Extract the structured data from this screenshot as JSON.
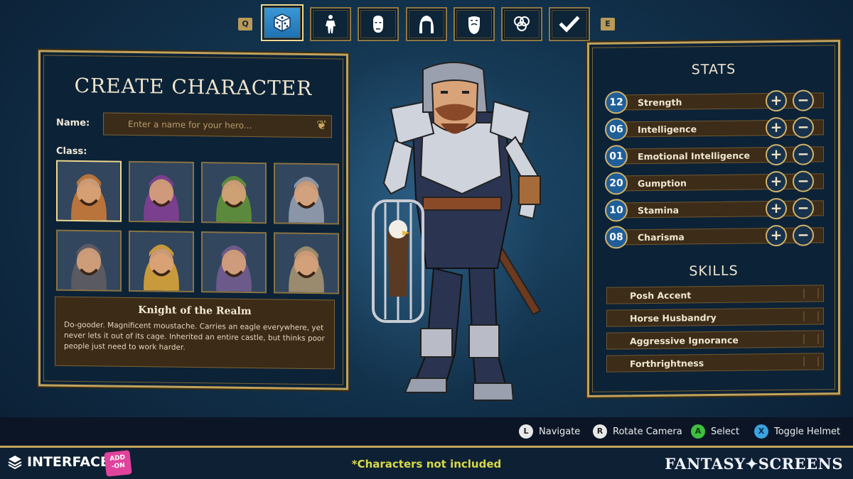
{
  "tabs": {
    "left_key": "Q",
    "right_key": "E",
    "items": [
      {
        "icon": "dice-icon",
        "active": true
      },
      {
        "icon": "body-icon",
        "active": false
      },
      {
        "icon": "face-icon",
        "active": false
      },
      {
        "icon": "hair-icon",
        "active": false
      },
      {
        "icon": "beard-icon",
        "active": false
      },
      {
        "icon": "color-rings-icon",
        "active": false
      },
      {
        "icon": "checkmark-icon",
        "active": false
      }
    ]
  },
  "create": {
    "title": "CREATE CHARACTER",
    "name_label": "Name:",
    "name_placeholder": "Enter a name for your hero...",
    "name_value": "",
    "class_label": "Class:",
    "classes": [
      {
        "portrait": "knight-portrait",
        "color": "#b9743b"
      },
      {
        "portrait": "witch-portrait",
        "color": "#7a3f8e"
      },
      {
        "portrait": "medusa-portrait",
        "color": "#5c8a3c"
      },
      {
        "portrait": "wizard-portrait",
        "color": "#8a95a8"
      },
      {
        "portrait": "bearded-warrior-portrait",
        "color": "#5a5a63"
      },
      {
        "portrait": "hooded-bard-portrait",
        "color": "#c99a3c"
      },
      {
        "portrait": "king-portrait",
        "color": "#6c5a8a"
      },
      {
        "portrait": "hunter-portrait",
        "color": "#9a8a6e"
      }
    ],
    "selected_class": {
      "name": "Knight of the Realm",
      "description": "Do-gooder.  Magnificent moustache.  Carries an eagle everywhere, yet never lets it out of its cage.  Inherited an entire castle, but thinks poor people just need to work harder."
    }
  },
  "stats": {
    "title": "STATS",
    "items": [
      {
        "value": "12",
        "name": "Strength"
      },
      {
        "value": "06",
        "name": "Intelligence"
      },
      {
        "value": "01",
        "name": "Emotional Intelligence"
      },
      {
        "value": "20",
        "name": "Gumption"
      },
      {
        "value": "10",
        "name": "Stamina"
      },
      {
        "value": "08",
        "name": "Charisma"
      }
    ],
    "plus_label": "+",
    "minus_label": "−"
  },
  "skills": {
    "title": "SKILLS",
    "items": [
      "Posh Accent",
      "Horse Husbandry",
      "Aggressive Ignorance",
      "Forthrightness"
    ]
  },
  "controls": [
    {
      "glyph": "L",
      "label": "Navigate",
      "color": "#e8e8e8",
      "text_color": "#222"
    },
    {
      "glyph": "R",
      "label": "Rotate Camera",
      "color": "#e8e8e8",
      "text_color": "#222"
    },
    {
      "glyph": "A",
      "label": "Select",
      "color": "#3fbf3f",
      "text_color": "#0c3a0c"
    },
    {
      "glyph": "X",
      "label": "Toggle Helmet",
      "color": "#3aa2e0",
      "text_color": "#0a2a48"
    }
  ],
  "footer": {
    "brand_left": "INTERFACE",
    "addon_line1": "ADD",
    "addon_line2": "-ON",
    "note": "*Characters not included",
    "brand_right": "FANTASY✦SCREENS"
  },
  "colors": {
    "gold": "#c2a35c",
    "panel": "#0c2236",
    "active_tab": "#2d86c8",
    "stat_circle": "#1f5e99"
  }
}
